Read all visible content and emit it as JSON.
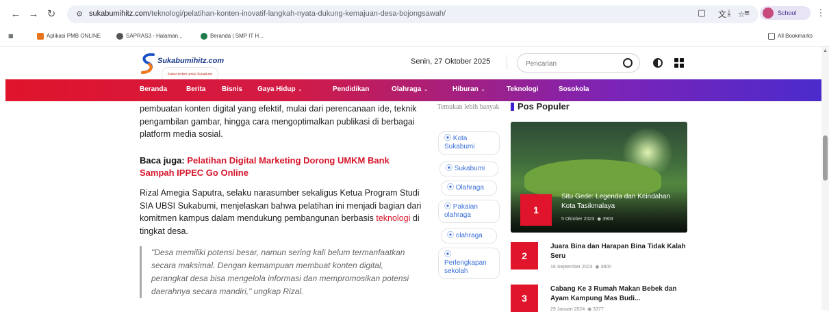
{
  "browser": {
    "url_domain": "sukabumihitz.com",
    "url_path": "/teknologi/pelatihan-konten-inovatif-langkah-nyata-dukung-kemajuan-desa-bojongsawah/",
    "profile_label": "School",
    "bookmarks": [
      {
        "label": "Aplikasi PMB ONLINE",
        "color": "#e8731b"
      },
      {
        "label": "SAPRAS3 - Halaman...",
        "color": "#555555"
      },
      {
        "label": "Beranda | SMP IT H...",
        "color": "#1f7a4a"
      }
    ],
    "all_bookmarks": "All Bookmarks"
  },
  "site": {
    "logo_name": "Sukabumihitz.com",
    "logo_tagline": "Kabar terkini untuk Sukabumi",
    "date": "Senin, 27 Oktober 2025",
    "search_placeholder": "Pencarian",
    "brand_colors": {
      "red": "#e0142b",
      "purple": "#4b2bcc",
      "link": "#d7162c"
    }
  },
  "nav": [
    {
      "label": "Beranda",
      "caret": ""
    },
    {
      "label": "Berita",
      "caret": ""
    },
    {
      "label": "Bisnis",
      "caret": ""
    },
    {
      "label": "Gaya Hidup",
      "caret": "⌄"
    },
    {
      "label": "Pendidikan",
      "caret": ""
    },
    {
      "label": "Olahraga",
      "caret": "⌄"
    },
    {
      "label": "Hiburan",
      "caret": "⌄"
    },
    {
      "label": "Teknologi",
      "caret": ""
    },
    {
      "label": "Sosokola",
      "caret": ""
    }
  ],
  "article": {
    "p1": "pembuatan konten digital yang efektif, mulai dari perencanaan ide, teknik pengambilan gambar, hingga cara mengoptimalkan publikasi di berbagai platform media sosial.",
    "baca_label": "Baca juga:",
    "baca_link": "Pelatihan Digital Marketing Dorong UMKM Bank Sampah IPPEC Go Online",
    "p2_before": "Rizal Amegia Saputra, selaku narasumber sekaligus Ketua Program Studi SIA UBSI Sukabumi, menjelaskan bahwa pelatihan ini menjadi bagian dari komitmen kampus dalam mendukung pembangunan berbasis ",
    "p2_link": "teknologi",
    "p2_after": " di tingkat desa.",
    "quote": "\"Desa memiliki potensi besar, namun sering kali belum termanfaatkan secara maksimal. Dengan kemampuan membuat konten digital, perangkat desa bisa mengelola informasi dan mempromosikan potensi daerahnya secara mandiri,\" ungkap Rizal."
  },
  "tags": {
    "heading": "Temukan lebih banyak",
    "items": [
      "⦿ Kota Sukabumi",
      "⦿ Sukabumi",
      "⦿ Olahraga",
      "⦿ Pakaian olahraga",
      "⦿ olahraga",
      "⦿ Perlengkapan sekolah"
    ]
  },
  "popular": {
    "title": "Pos Populer",
    "items": [
      {
        "num": "1",
        "title": "Situ Gede: Legenda dan Keindahan Kota Tasikmalaya",
        "date": "5 Oktober 2023",
        "views": "3904"
      },
      {
        "num": "2",
        "title": "Juara Bina dan Harapan Bina Tidak Kalah Seru",
        "date": "16 September 2023",
        "views": "3800"
      },
      {
        "num": "3",
        "title": "Cabang Ke 3 Rumah Makan Bebek dan Ayam Kampung Mas Budi...",
        "date": "29 Januari 2024",
        "views": "3377"
      }
    ]
  }
}
